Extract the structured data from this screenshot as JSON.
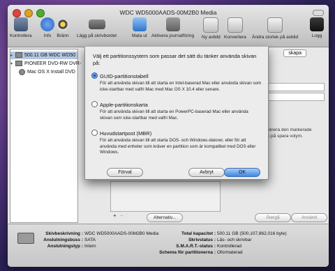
{
  "window": {
    "title": "WDC WD5000AADS-00M2B0 Media"
  },
  "toolbar": {
    "items": [
      {
        "label": "Kontrollera",
        "icon": "microscope-icon"
      },
      {
        "label": "Info",
        "icon": "info-icon"
      },
      {
        "label": "Bränn",
        "icon": "burn-icon"
      },
      {
        "label": "Lägg på skrivbordet",
        "icon": "mount-icon"
      },
      {
        "label": "Mata ut",
        "icon": "eject-icon"
      },
      {
        "label": "Aktivera journalföring",
        "icon": "journaling-icon"
      },
      {
        "label": "Ny avbild",
        "icon": "new-image-icon"
      },
      {
        "label": "Konvertera",
        "icon": "convert-icon"
      },
      {
        "label": "Ändra storlek på avbild",
        "icon": "resize-image-icon"
      },
      {
        "label": "Logg",
        "icon": "log-icon"
      }
    ]
  },
  "sidebar": {
    "items": [
      {
        "label": "500.11 GB WDC WD50",
        "selected": true
      },
      {
        "label": "PIONEER DVD-RW DVR-"
      },
      {
        "label": "Mac OS X Install DVD"
      }
    ]
  },
  "background": {
    "tab_partition": "skapa",
    "dropdown_text": "rald)",
    "right_text_1": "ionera den markerade",
    "right_text_2": "k på spara volym.",
    "add_button": "+",
    "remove_button": "−",
    "options_button": "Alternativ...",
    "revert_button": "Återgå",
    "apply_button": "Använd"
  },
  "dialog": {
    "prompt": "Välj ett partitionssystem som passar det sätt du tänker använda skivan på:",
    "options": [
      {
        "title": "GUID-partitionstabell",
        "desc": "För att använda skivan till att starta en Intel-baserad Mac eller använda skivan som icke-startbar med valfri Mac med Mac OS X 10.4 eller senare.",
        "selected": true
      },
      {
        "title": "Apple-partitionskarta",
        "desc": "För att använda skivan till att starta en PowerPC-baserad Mac eller använda skivan som icke-startbar med valfri Mac.",
        "selected": false
      },
      {
        "title": "Huvudstartpost (MBR)",
        "desc": "För att använda skivan till att starta DOS- och Windows-datorer, eller för att använda med enheter som kräver en partition som är kompatibel med DOS eller Windows.",
        "selected": false
      }
    ],
    "default_button": "Förval",
    "cancel_button": "Avbryt",
    "ok_button": "OK"
  },
  "info": {
    "left": [
      {
        "label": "Skivbeskrivning :",
        "value": "WDC WD5000AADS-00M2B0 Media"
      },
      {
        "label": "Anslutningsbuss :",
        "value": "SATA"
      },
      {
        "label": "Anslutningstyp :",
        "value": "Intern"
      }
    ],
    "right": [
      {
        "label": "Total kapacitet :",
        "value": "500.11 GB (500,107,862,016 byte)"
      },
      {
        "label": "Skrivstatus :",
        "value": "Läs- och skrivbar"
      },
      {
        "label": "S.M.A.R.T.-status :",
        "value": "Kontrollerad"
      },
      {
        "label": "Schema för partitionerna :",
        "value": "Oformaterad"
      }
    ]
  }
}
